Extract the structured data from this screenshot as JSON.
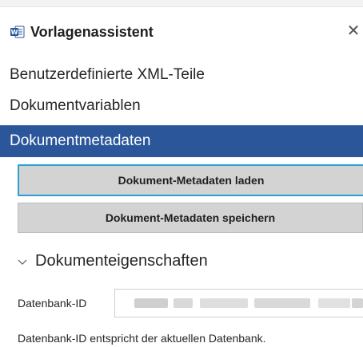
{
  "window": {
    "title": "Vorlagenassistent",
    "close_glyph": "✕",
    "app_icon": "word-doc-icon"
  },
  "nav": {
    "items": [
      {
        "label": "Benutzerdefinierte XML-Teile"
      },
      {
        "label": "Dokumentvariablen"
      },
      {
        "label": "Dokumentmetadaten",
        "selected": true
      }
    ]
  },
  "actions": {
    "load_label": "Dokument-Metadaten laden",
    "save_label": "Dokument-Metadaten speichern"
  },
  "section": {
    "title": "Dokumenteigenschaften",
    "expanded": true
  },
  "fields": {
    "database_id": {
      "label": "Datenbank-ID",
      "value": ""
    }
  },
  "status": {
    "message": "Datenbank-ID entspricht der aktuellen Datenbank."
  },
  "colors": {
    "selected_nav_bg": "#2b579a",
    "focus_border": "#2aa0d6",
    "button_bg": "#d3d3d3"
  }
}
